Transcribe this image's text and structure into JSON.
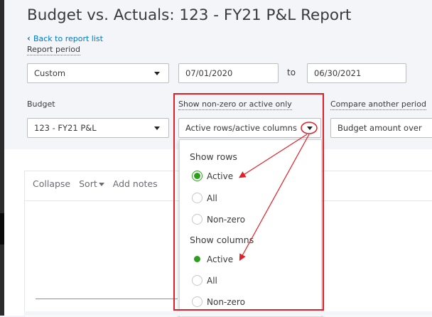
{
  "page": {
    "title": "Budget vs. Actuals: 123 - FY21 P&L Report",
    "back_link": "Back to report list"
  },
  "report_period": {
    "label": "Report period",
    "period_value": "Custom",
    "start_date": "07/01/2020",
    "to_label": "to",
    "end_date": "06/30/2021"
  },
  "budget": {
    "label": "Budget",
    "value": "123 - FY21 P&L"
  },
  "show_nonzero": {
    "label": "Show non-zero or active only",
    "value": "Active rows/active columns"
  },
  "compare": {
    "label": "Compare another period",
    "value": "Budget amount over"
  },
  "toolbar": {
    "collapse": "Collapse",
    "sort": "Sort",
    "add_notes": "Add notes"
  },
  "dropdown": {
    "rows_title": "Show rows",
    "rows": [
      {
        "label": "Active",
        "selected": true
      },
      {
        "label": "All",
        "selected": false
      },
      {
        "label": "Non-zero",
        "selected": false
      }
    ],
    "columns_title": "Show columns",
    "columns": [
      {
        "label": "Active",
        "selected": true
      },
      {
        "label": "All",
        "selected": false
      },
      {
        "label": "Non-zero",
        "selected": false
      }
    ]
  },
  "colors": {
    "accent_green": "#2ca01c",
    "link_blue": "#0077c5",
    "annotation_red": "#e01f27"
  }
}
